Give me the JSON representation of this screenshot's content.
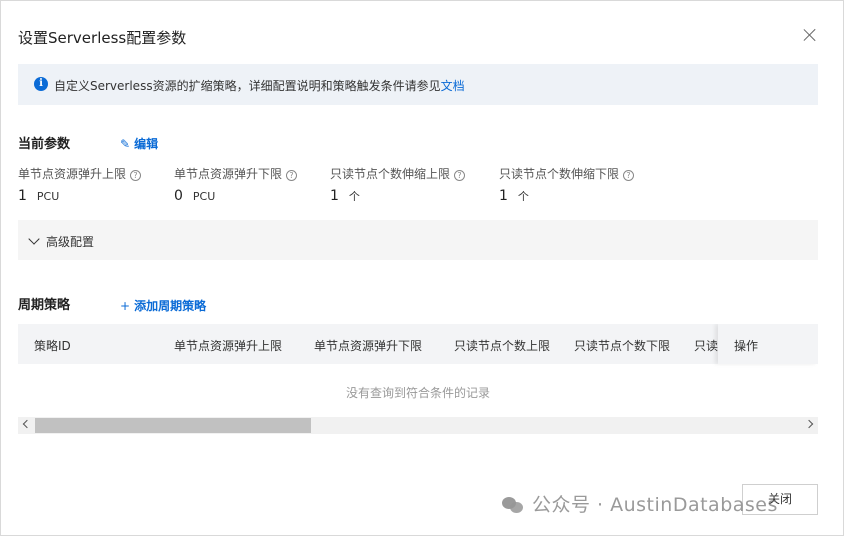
{
  "dialog": {
    "title": "设置Serverless配置参数"
  },
  "notice": {
    "text": "自定义Serverless资源的扩缩策略，详细配置说明和策略触发条件请参见",
    "link": "文档"
  },
  "current": {
    "title": "当前参数",
    "edit_label": "编辑",
    "params": [
      {
        "label": "单节点资源弹升上限",
        "value": "1",
        "unit": "PCU"
      },
      {
        "label": "单节点资源弹升下限",
        "value": "0",
        "unit": "PCU"
      },
      {
        "label": "只读节点个数伸缩上限",
        "value": "1",
        "unit": "个"
      },
      {
        "label": "只读节点个数伸缩下限",
        "value": "1",
        "unit": "个"
      }
    ]
  },
  "advanced": {
    "label": "高级配置"
  },
  "schedule": {
    "title": "周期策略",
    "add_label": "添加周期策略",
    "columns": [
      "策略ID",
      "单节点资源弹升上限",
      "单节点资源弹升下限",
      "只读节点个数上限",
      "只读节点个数下限",
      "只读"
    ],
    "op_column": "操作",
    "empty_text": "没有查询到符合条件的记录",
    "scroll_fraction": 0.36
  },
  "footer": {
    "close_label": "关闭"
  },
  "watermark": {
    "text": "公众号 · AustinDatabases"
  },
  "colors": {
    "accent": "#0b6bd6",
    "notice_bg": "#eef2f7",
    "header_bg": "#f3f4f6"
  }
}
